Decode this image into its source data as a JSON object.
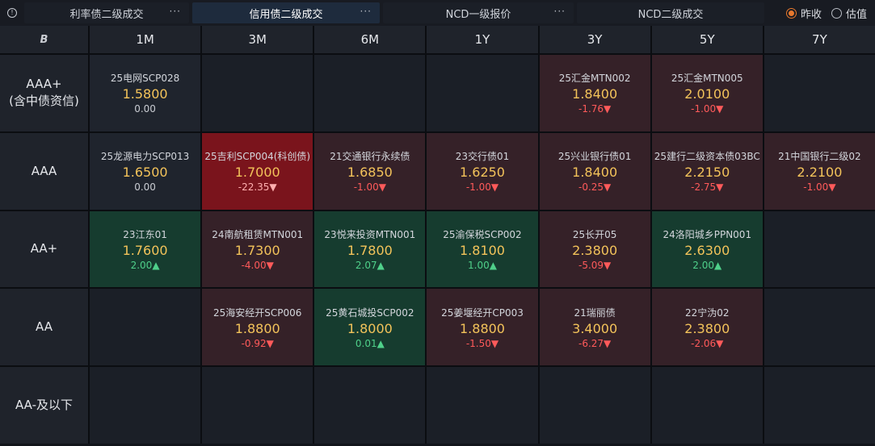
{
  "tabs": [
    {
      "label": "利率债二级成交",
      "active": false
    },
    {
      "label": "信用债二级成交",
      "active": true
    },
    {
      "label": "NCD一级报价",
      "active": false
    },
    {
      "label": "NCD二级成交",
      "active": false
    }
  ],
  "more_label": "···",
  "radio_options": [
    {
      "label": "昨收",
      "selected": true
    },
    {
      "label": "估值",
      "selected": false
    }
  ],
  "corner_label": "B",
  "columns": [
    "1M",
    "3M",
    "6M",
    "1Y",
    "3Y",
    "5Y",
    "7Y"
  ],
  "rows": [
    {
      "label_lines": [
        "AAA+",
        "(含中债资信)"
      ],
      "cells": [
        {
          "name": "25电网SCP028",
          "value": "1.5800",
          "change": "0.00",
          "trend": "neutral"
        },
        null,
        null,
        null,
        {
          "name": "25汇金MTN002",
          "value": "1.8400",
          "change": "-1.76▼",
          "trend": "down"
        },
        {
          "name": "25汇金MTN005",
          "value": "2.0100",
          "change": "-1.00▼",
          "trend": "down"
        },
        null
      ]
    },
    {
      "label_lines": [
        "AAA"
      ],
      "cells": [
        {
          "name": "25龙源电力SCP013",
          "value": "1.6500",
          "change": "0.00",
          "trend": "neutral"
        },
        {
          "name": "25吉利SCP004(科创债)",
          "value": "1.7000",
          "change": "-22.35▼",
          "trend": "strong-down"
        },
        {
          "name": "21交通银行永续债",
          "value": "1.6850",
          "change": "-1.00▼",
          "trend": "down"
        },
        {
          "name": "23交行债01",
          "value": "1.6250",
          "change": "-1.00▼",
          "trend": "down"
        },
        {
          "name": "25兴业银行债01",
          "value": "1.8400",
          "change": "-0.25▼",
          "trend": "down"
        },
        {
          "name": "25建行二级资本债03BC",
          "value": "2.2150",
          "change": "-2.75▼",
          "trend": "down"
        },
        {
          "name": "21中国银行二级02",
          "value": "2.2100",
          "change": "-1.00▼",
          "trend": "down"
        }
      ]
    },
    {
      "label_lines": [
        "AA+"
      ],
      "cells": [
        {
          "name": "23江东01",
          "value": "1.7600",
          "change": "2.00▲",
          "trend": "up"
        },
        {
          "name": "24南航租赁MTN001",
          "value": "1.7300",
          "change": "-4.00▼",
          "trend": "down"
        },
        {
          "name": "23悦来投资MTN001",
          "value": "1.7800",
          "change": "2.07▲",
          "trend": "up"
        },
        {
          "name": "25渝保税SCP002",
          "value": "1.8100",
          "change": "1.00▲",
          "trend": "up"
        },
        {
          "name": "25长开05",
          "value": "2.3800",
          "change": "-5.09▼",
          "trend": "down"
        },
        {
          "name": "24洛阳城乡PPN001",
          "value": "2.6300",
          "change": "2.00▲",
          "trend": "up"
        },
        null
      ]
    },
    {
      "label_lines": [
        "AA"
      ],
      "cells": [
        null,
        {
          "name": "25海安经开SCP006",
          "value": "1.8800",
          "change": "-0.92▼",
          "trend": "down"
        },
        {
          "name": "25黄石城投SCP002",
          "value": "1.8000",
          "change": "0.01▲",
          "trend": "up"
        },
        {
          "name": "25姜堰经开CP003",
          "value": "1.8800",
          "change": "-1.50▼",
          "trend": "down"
        },
        {
          "name": "21瑞丽债",
          "value": "3.4000",
          "change": "-6.27▼",
          "trend": "down"
        },
        {
          "name": "22宁沩02",
          "value": "2.3800",
          "change": "-2.06▼",
          "trend": "down"
        },
        null
      ]
    },
    {
      "label_lines": [
        "AA-及以下"
      ],
      "cells": [
        null,
        null,
        null,
        null,
        null,
        null,
        null
      ]
    }
  ]
}
